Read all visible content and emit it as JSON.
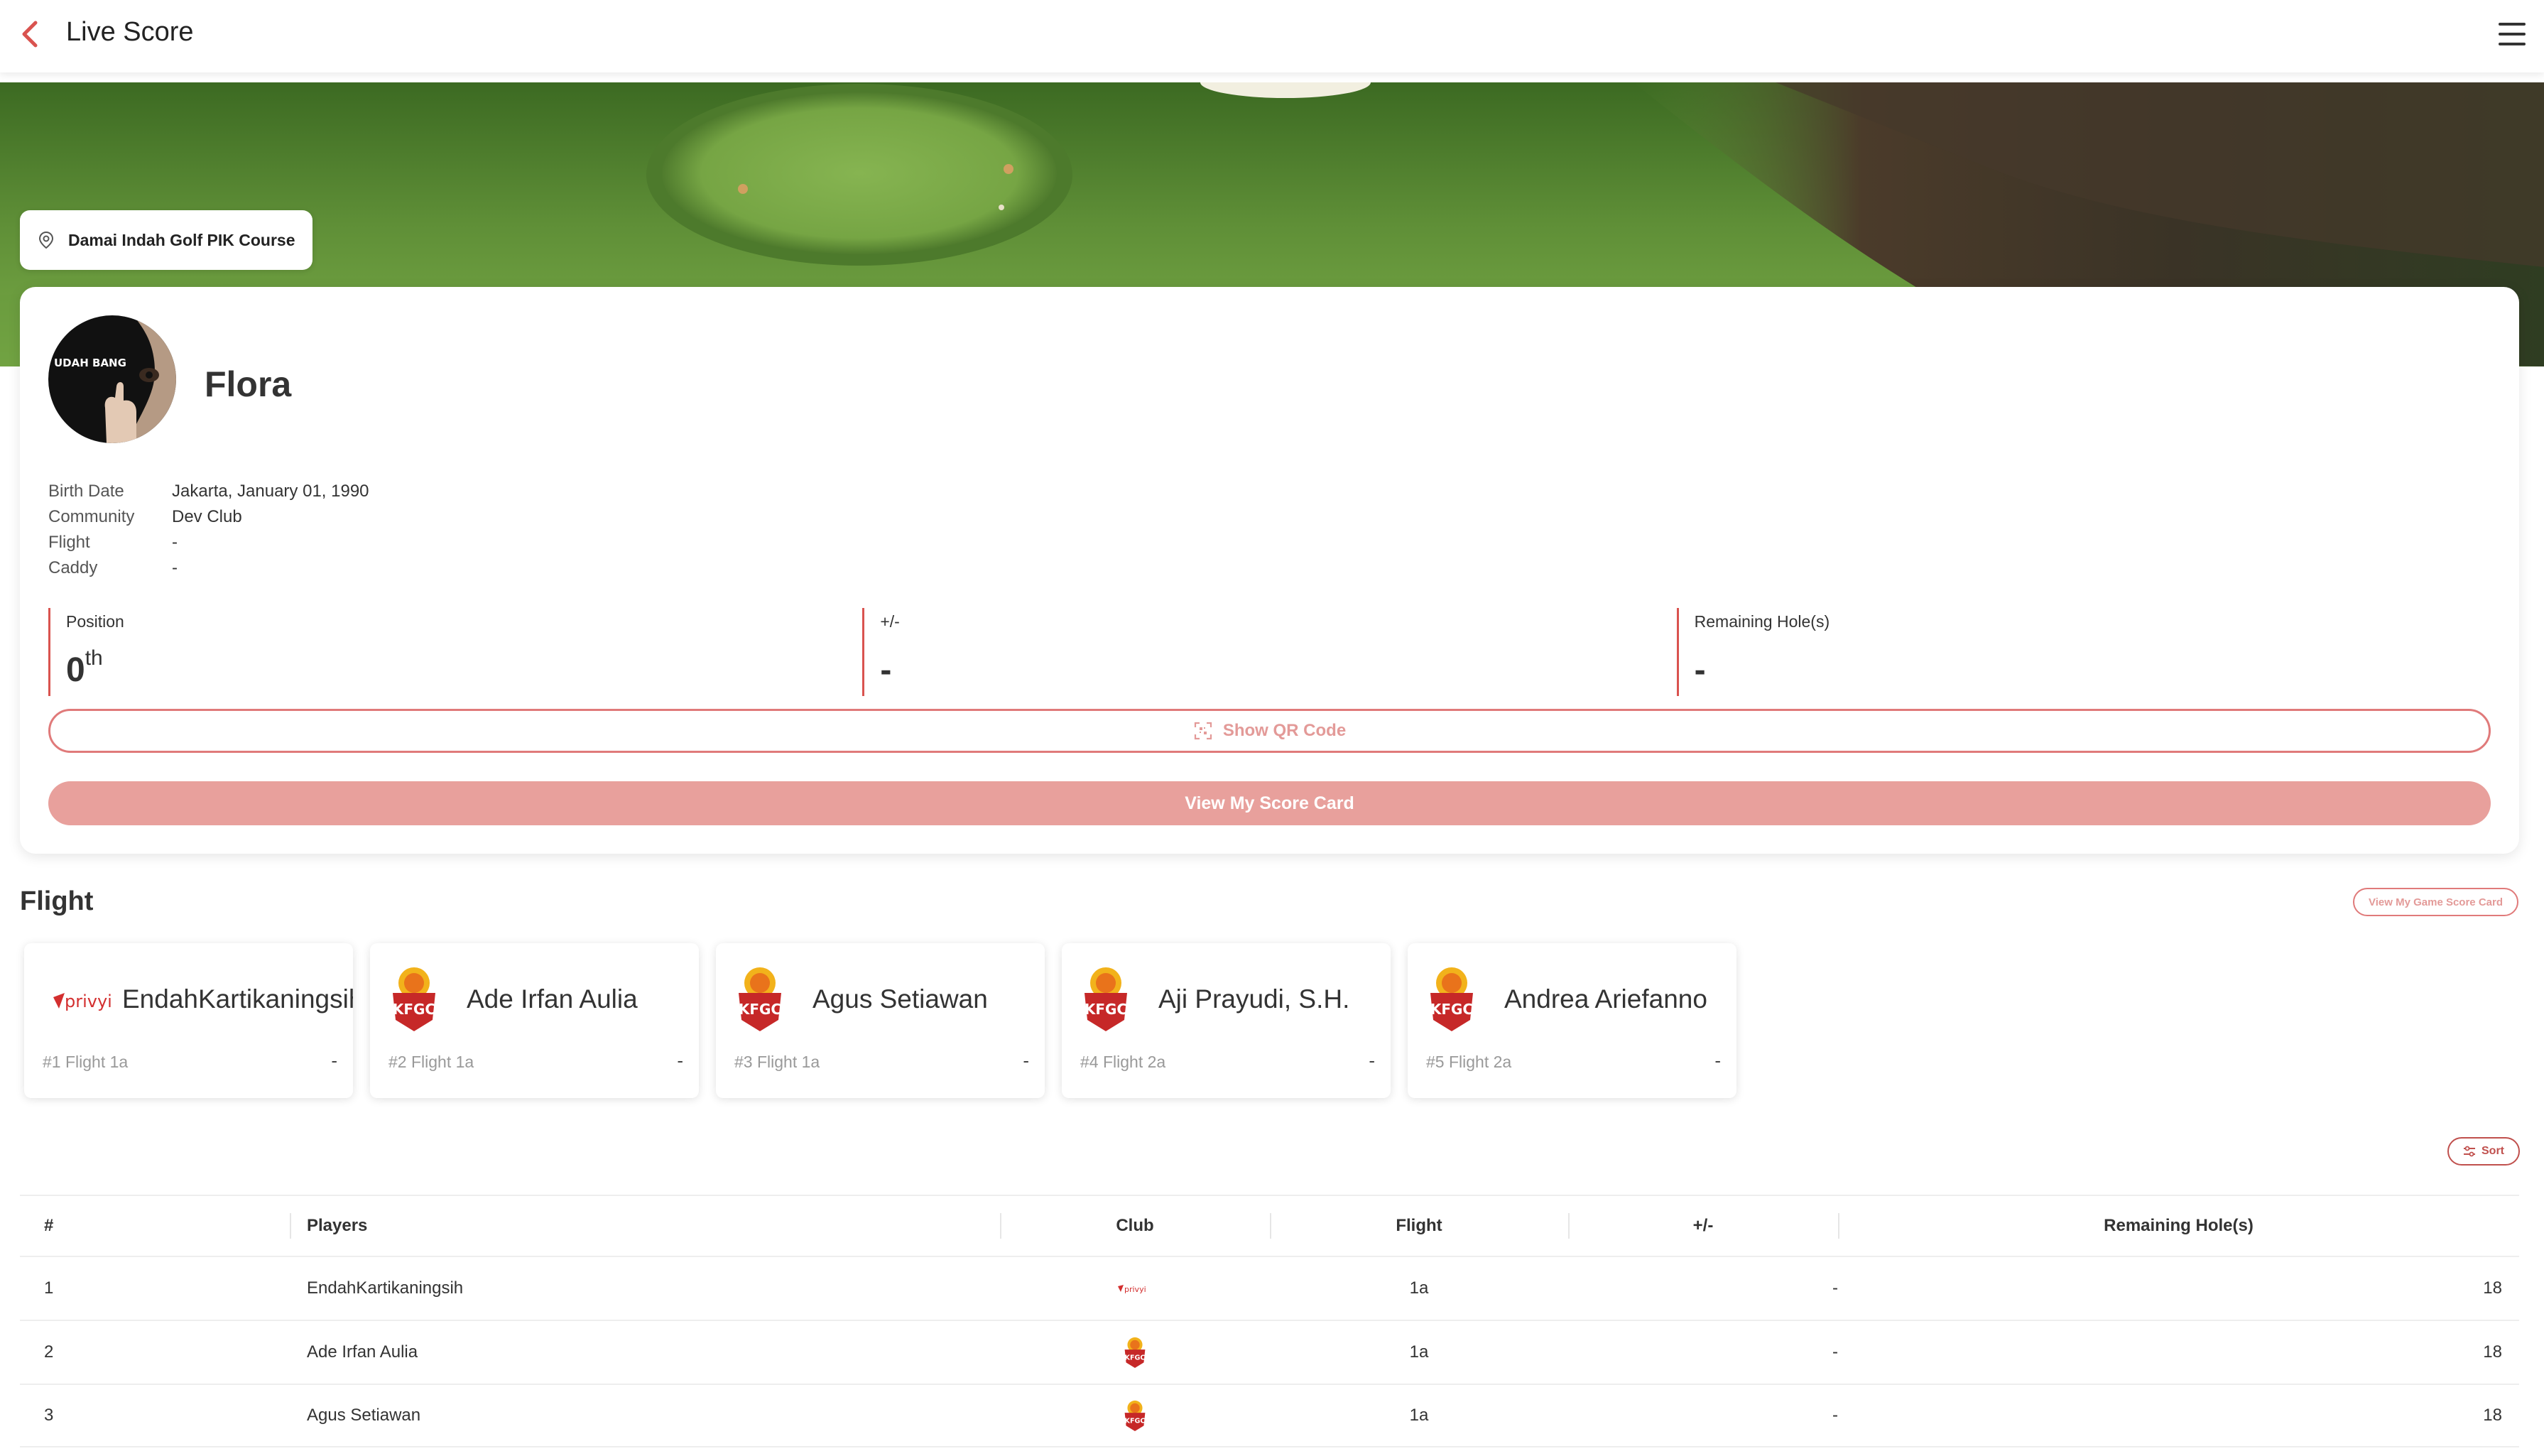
{
  "header": {
    "title": "Live Score"
  },
  "hero": {
    "location": "Damai Indah Golf PIK Course"
  },
  "profile": {
    "avatar_text": "UDAH BANG",
    "name": "Flora",
    "info": [
      {
        "label": "Birth Date",
        "value": "Jakarta, January 01, 1990"
      },
      {
        "label": "Community",
        "value": "Dev Club"
      },
      {
        "label": "Flight",
        "value": "-"
      },
      {
        "label": "Caddy",
        "value": "-"
      }
    ],
    "stats": {
      "position_label": "Position",
      "position_value": "0",
      "position_suffix": "th",
      "plusminus_label": "+/-",
      "plusminus_value": "-",
      "remaining_label": "Remaining Hole(s)",
      "remaining_value": "-"
    },
    "qr_button": "Show QR Code",
    "scorecard_button": "View My Score Card"
  },
  "flight": {
    "title": "Flight",
    "game_scorecard_button": "View My Game Score Card",
    "players": [
      {
        "name": "EndahKartikaningsih",
        "meta": "#1 Flight 1a",
        "score": "-",
        "club": "privy"
      },
      {
        "name": "Ade Irfan Aulia",
        "meta": "#2 Flight 1a",
        "score": "-",
        "club": "kfgc"
      },
      {
        "name": "Agus Setiawan",
        "meta": "#3 Flight 1a",
        "score": "-",
        "club": "kfgc"
      },
      {
        "name": "Aji Prayudi, S.H.",
        "meta": "#4 Flight 2a",
        "score": "-",
        "club": "kfgc"
      },
      {
        "name": "Andrea Ariefanno",
        "meta": "#5 Flight 2a",
        "score": "-",
        "club": "kfgc"
      }
    ]
  },
  "sort_button": "Sort",
  "logos": {
    "privy": "privyi",
    "kfgc": "KFGC"
  },
  "table": {
    "headers": {
      "rank": "#",
      "players": "Players",
      "club": "Club",
      "flight": "Flight",
      "plusminus": "+/-",
      "remaining": "Remaining Hole(s)"
    },
    "rows": [
      {
        "rank": "1",
        "player": "EndahKartikaningsih",
        "club": "privy",
        "flight": "1a",
        "plusminus": "-",
        "remaining": "18"
      },
      {
        "rank": "2",
        "player": "Ade Irfan Aulia",
        "club": "kfgc",
        "flight": "1a",
        "plusminus": "-",
        "remaining": "18"
      },
      {
        "rank": "3",
        "player": "Agus Setiawan",
        "club": "kfgc",
        "flight": "1a",
        "plusminus": "-",
        "remaining": "18"
      }
    ]
  },
  "colors": {
    "accent": "#d9534f",
    "accent_light": "#e8a09c",
    "grass": "#6fa03f"
  }
}
